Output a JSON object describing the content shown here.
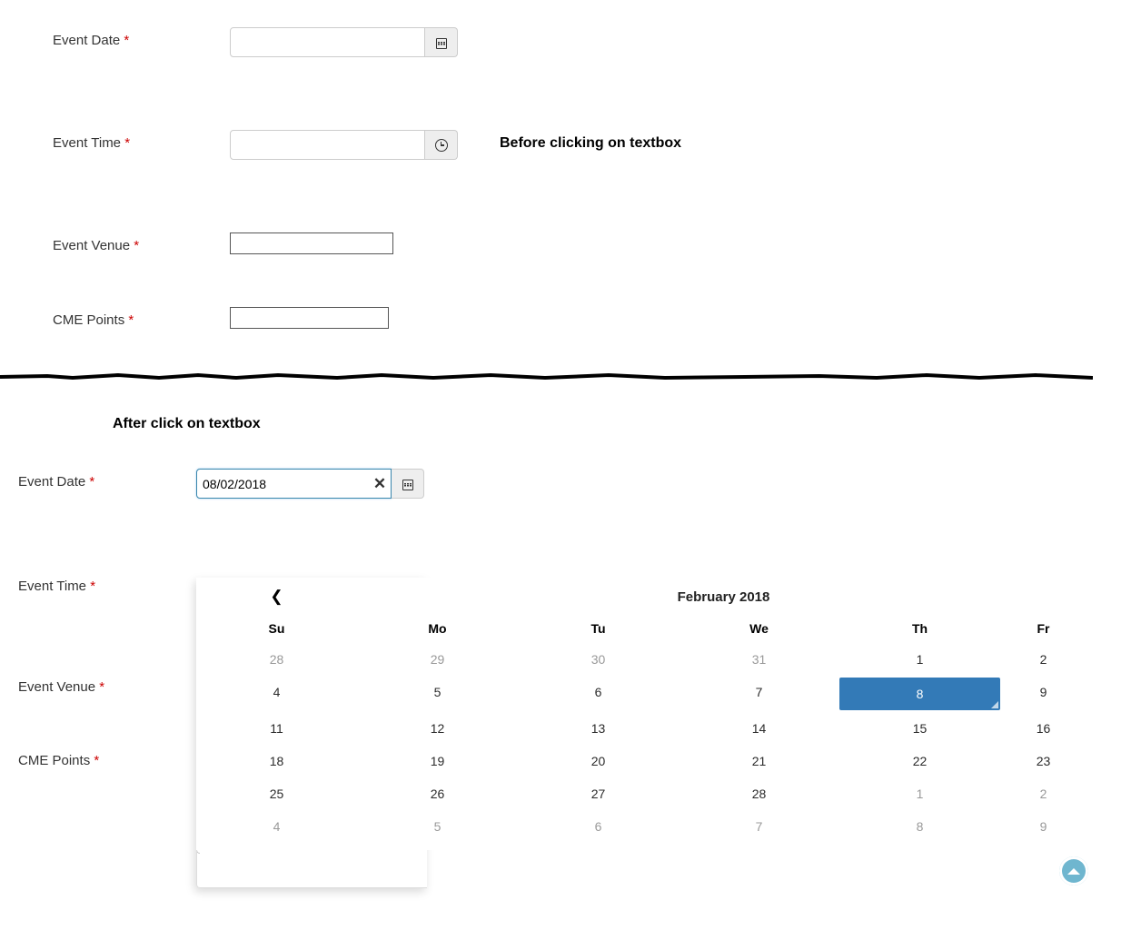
{
  "before": {
    "note": "Before clicking on textbox",
    "fields": {
      "date": {
        "label": "Event Date",
        "value": ""
      },
      "time": {
        "label": "Event Time",
        "value": ""
      },
      "venue": {
        "label": "Event Venue",
        "value": ""
      },
      "cme": {
        "label": "CME Points",
        "value": ""
      }
    }
  },
  "after": {
    "note": "After click on textbox",
    "fields": {
      "date": {
        "label": "Event Date",
        "value": "08/02/2018"
      },
      "time": {
        "label": "Event Time",
        "value": ""
      },
      "venue": {
        "label": "Event Venue",
        "value": ""
      },
      "cme": {
        "label": "CME Points",
        "value": ""
      }
    }
  },
  "calendar": {
    "title": "February 2018",
    "dow": [
      "Su",
      "Mo",
      "Tu",
      "We",
      "Th",
      "Fr"
    ],
    "selected_day": "8",
    "weeks": [
      {
        "days": [
          {
            "d": "28",
            "muted": true
          },
          {
            "d": "29",
            "muted": true
          },
          {
            "d": "30",
            "muted": true
          },
          {
            "d": "31",
            "muted": true
          },
          {
            "d": "1"
          },
          {
            "d": "2"
          }
        ]
      },
      {
        "days": [
          {
            "d": "4"
          },
          {
            "d": "5"
          },
          {
            "d": "6"
          },
          {
            "d": "7"
          },
          {
            "d": "8",
            "selected": true
          },
          {
            "d": "9"
          }
        ]
      },
      {
        "days": [
          {
            "d": "11"
          },
          {
            "d": "12"
          },
          {
            "d": "13"
          },
          {
            "d": "14"
          },
          {
            "d": "15"
          },
          {
            "d": "16"
          }
        ]
      },
      {
        "days": [
          {
            "d": "18"
          },
          {
            "d": "19"
          },
          {
            "d": "20"
          },
          {
            "d": "21"
          },
          {
            "d": "22"
          },
          {
            "d": "23"
          }
        ]
      },
      {
        "days": [
          {
            "d": "25"
          },
          {
            "d": "26"
          },
          {
            "d": "27"
          },
          {
            "d": "28"
          },
          {
            "d": "1",
            "muted": true
          },
          {
            "d": "2",
            "muted": true
          }
        ]
      },
      {
        "days": [
          {
            "d": "4",
            "muted": true
          },
          {
            "d": "5",
            "muted": true
          },
          {
            "d": "6",
            "muted": true
          },
          {
            "d": "7",
            "muted": true
          },
          {
            "d": "8",
            "muted": true
          },
          {
            "d": "9",
            "muted": true
          }
        ]
      }
    ]
  },
  "required_marker": "*"
}
